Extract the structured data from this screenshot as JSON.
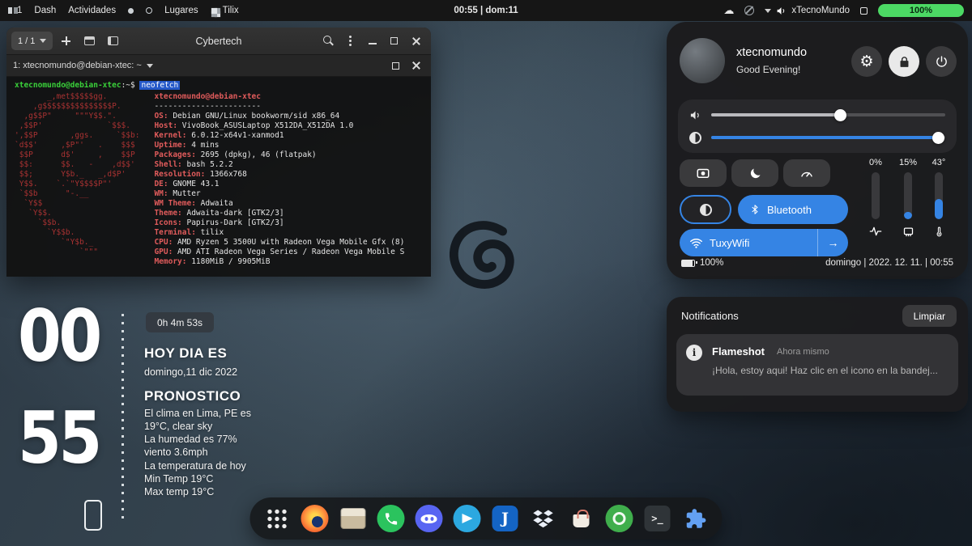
{
  "icons": {
    "gear": "⚙",
    "cloud": "☁",
    "arrow": "→",
    "info": "i"
  },
  "topbar": {
    "workspace": "1",
    "menu_dash": "Dash",
    "menu_activities": "Actividades",
    "menu_places": "Lugares",
    "menu_tilix": "Tilix",
    "clock": "00:55 | dom:11",
    "system_label": "xTecnoMundo",
    "battery_percent": "100%"
  },
  "terminal": {
    "tabs_indicator": "1 / 1",
    "window_title": "Cybertech",
    "tab_label": "1: xtecnomundo@debian-xtec: ~",
    "prompt_user": "xtecnomundo@debian-xtec",
    "prompt_suffix": ":~$",
    "prompt_command": "neofetch",
    "ascii_art": [
      "       _,met$$$$$gg.",
      "    ,g$$$$$$$$$$$$$$$P.",
      "  ,g$$P\"     \"\"\"Y$$.\".",
      " ,$$P'              `$$$.",
      "',$$P       ,ggs.     `$$b:",
      "`d$$'     ,$P\"'   .    $$$",
      " $$P      d$'     ,    $$P",
      " $$:      $$.   -    ,d$$'",
      " $$;      Y$b._   _,d$P'",
      " Y$$.    `.`\"Y$$$$P\"'",
      " `$$b      \"-.__",
      "  `Y$$",
      "   `Y$$.",
      "     `$$b.",
      "       `Y$$b.",
      "          `\"Y$b._",
      "              `\"\"\""
    ],
    "neofetch": {
      "title": "xtecnomundo@debian-xtec",
      "separator": "-----------------------",
      "entries": [
        {
          "label": "OS",
          "value": "Debian GNU/Linux bookworm/sid x86_64"
        },
        {
          "label": "Host",
          "value": "VivoBook_ASUSLaptop X512DA_X512DA 1.0"
        },
        {
          "label": "Kernel",
          "value": "6.0.12-x64v1-xanmod1"
        },
        {
          "label": "Uptime",
          "value": "4 mins"
        },
        {
          "label": "Packages",
          "value": "2695 (dpkg), 46 (flatpak)"
        },
        {
          "label": "Shell",
          "value": "bash 5.2.2"
        },
        {
          "label": "Resolution",
          "value": "1366x768"
        },
        {
          "label": "DE",
          "value": "GNOME 43.1"
        },
        {
          "label": "WM",
          "value": "Mutter"
        },
        {
          "label": "WM Theme",
          "value": "Adwaita"
        },
        {
          "label": "Theme",
          "value": "Adwaita-dark [GTK2/3]"
        },
        {
          "label": "Icons",
          "value": "Papirus-Dark [GTK2/3]"
        },
        {
          "label": "Terminal",
          "value": "tilix"
        },
        {
          "label": "CPU",
          "value": "AMD Ryzen 5 3500U with Radeon Vega Mobile Gfx (8)"
        },
        {
          "label": "GPU",
          "value": "AMD ATI Radeon Vega Series / Radeon Vega Mobile S"
        },
        {
          "label": "Memory",
          "value": "1180MiB / 9905MiB"
        }
      ]
    }
  },
  "conky": {
    "clock_hour": "00",
    "clock_minute": "55",
    "uptime": "0h 4m 53s",
    "date_heading": "HOY DIA ES",
    "date_text": "domingo,11 dic 2022",
    "forecast_heading": "PRONOSTICO",
    "forecast_lines": [
      "El clima en Lima, PE es",
      "19°C, clear sky",
      "La humedad es 77%",
      "viento 3.6mph"
    ],
    "temperature_lines": [
      "La temperatura de hoy",
      "Min Temp 19°C",
      "Max temp 19°C"
    ]
  },
  "quick_settings": {
    "user_name": "xtecnomundo",
    "greeting": "Good Evening!",
    "volume_percent": 55,
    "brightness_percent": 97,
    "meters": [
      {
        "label": "0%",
        "value": 0
      },
      {
        "label": "15%",
        "value": 15
      },
      {
        "label": "43°",
        "value": 43
      }
    ],
    "bluetooth_label": "Bluetooth",
    "wifi_label": "TuxyWifi",
    "battery_label": "100%",
    "datetime": "domingo | 2022. 12. 11. | 00:55"
  },
  "notifications": {
    "title": "Notifications",
    "clear_button": "Limpiar",
    "items": [
      {
        "app": "Flameshot",
        "time": "Ahora mismo",
        "body": "¡Hola, estoy aqui! Haz clic en el icono en la bandej..."
      }
    ]
  },
  "dock": {
    "items": [
      {
        "name": "app-grid"
      },
      {
        "name": "firefox"
      },
      {
        "name": "files"
      },
      {
        "name": "whatsapp"
      },
      {
        "name": "discord"
      },
      {
        "name": "telegram"
      },
      {
        "name": "joplin",
        "glyph": "J"
      },
      {
        "name": "dropbox"
      },
      {
        "name": "software"
      },
      {
        "name": "green-app"
      },
      {
        "name": "tilix",
        "glyph": ">_"
      },
      {
        "name": "extensions"
      }
    ]
  }
}
